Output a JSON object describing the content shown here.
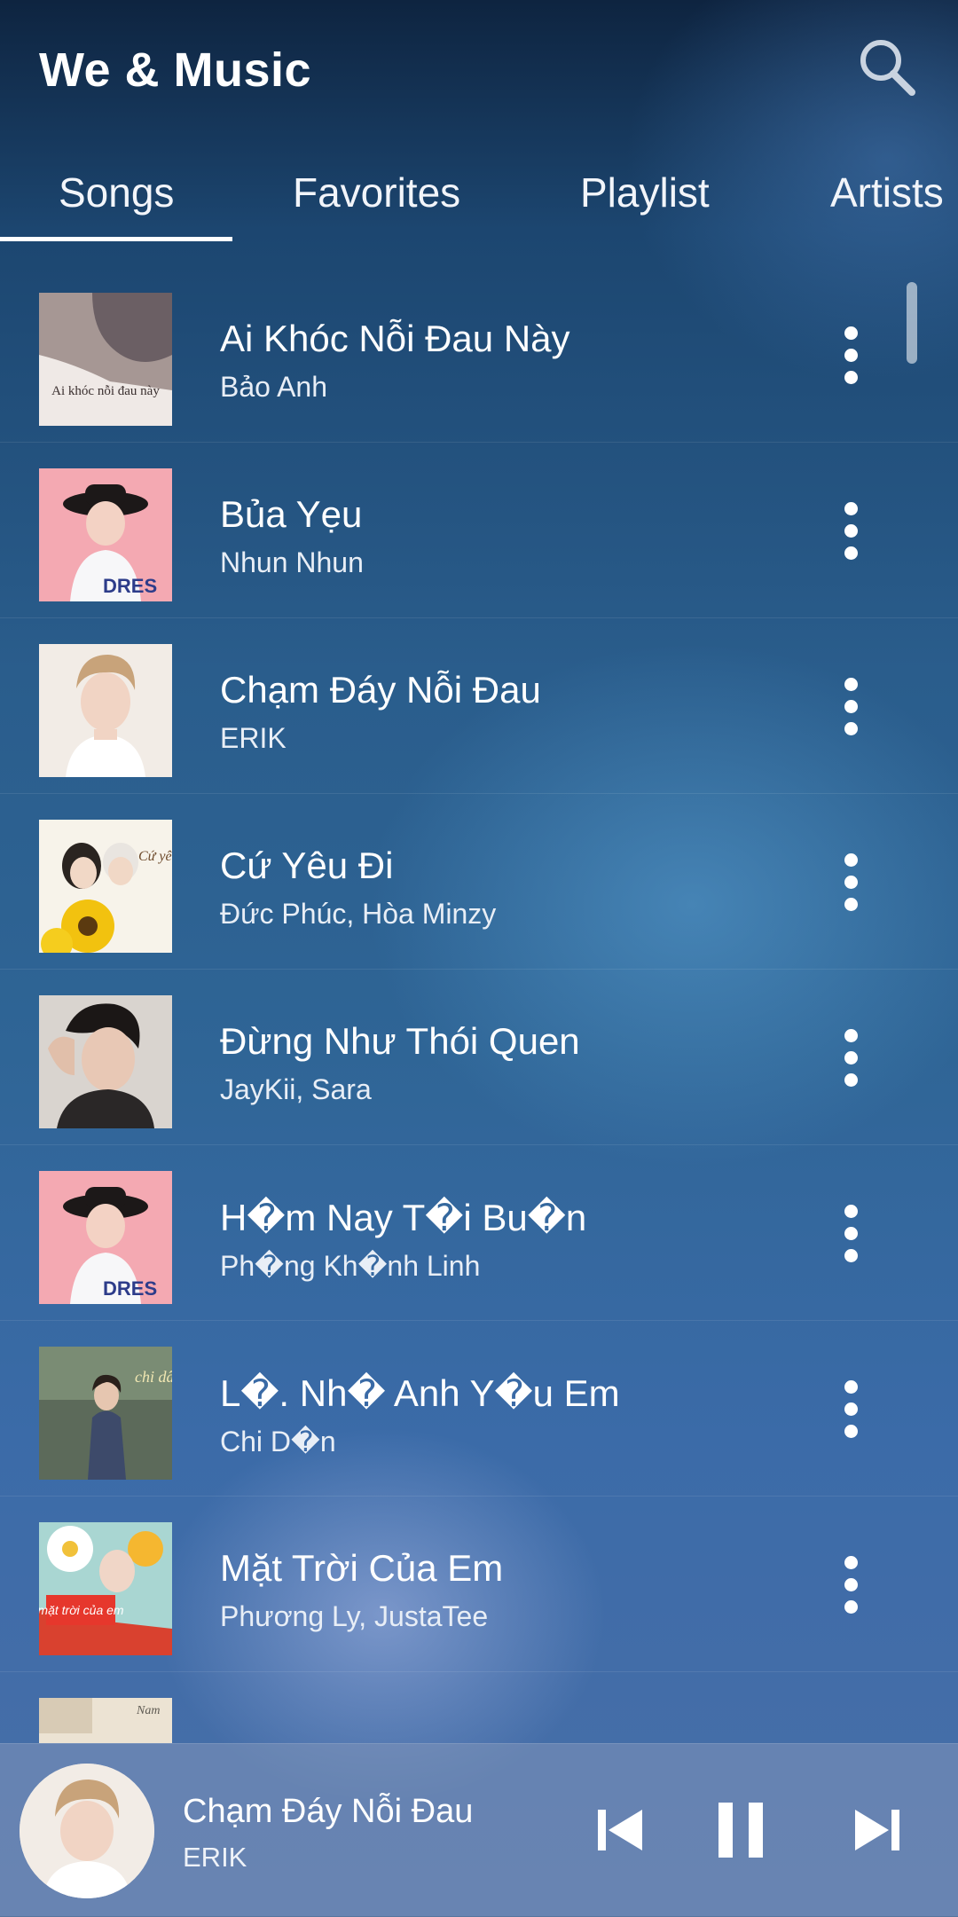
{
  "app": {
    "title": "We & Music"
  },
  "header": {
    "search_icon": "search-icon"
  },
  "tabs": [
    {
      "label": "Songs",
      "active": true
    },
    {
      "label": "Favorites",
      "active": false
    },
    {
      "label": "Playlist",
      "active": false
    },
    {
      "label": "Artists",
      "active": false
    }
  ],
  "songs": [
    {
      "title": "Ai Khóc Nỗi Đau Này",
      "artist": "Bảo Anh",
      "cover_text": "Ai khóc nỗi đau này"
    },
    {
      "title": "Bủa Yẹu",
      "artist": "Nhun Nhun",
      "cover_text": ""
    },
    {
      "title": "Chạm Đáy Nỗi Đau",
      "artist": "ERIK",
      "cover_text": ""
    },
    {
      "title": "Cứ Yêu Đi",
      "artist": "Đức Phúc, Hòa Minzy",
      "cover_text": "Cứ yêu đi"
    },
    {
      "title": "Đừng Như Thói Quen",
      "artist": "JayKii, Sara",
      "cover_text": ""
    },
    {
      "title": "H�m Nay T�i Bu�n",
      "artist": "Ph�ng Kh�nh Linh",
      "cover_text": ""
    },
    {
      "title": "L�. Nh� Anh Y�u Em",
      "artist": "Chi D�n",
      "cover_text": "chi dân"
    },
    {
      "title": "Mặt Trời Của Em",
      "artist": "Phương Ly, JustaTee",
      "cover_text": "mặt trời của em"
    },
    {
      "title": "",
      "artist": "",
      "cover_text": "Nam"
    }
  ],
  "player": {
    "title": "Chạm Đáy Nỗi Đau",
    "artist": "ERIK",
    "state": "playing",
    "controls": {
      "previous": "skip-previous-icon",
      "pause": "pause-icon",
      "next": "skip-next-icon"
    }
  },
  "colors": {
    "background_top": "#0e2440",
    "background_mid": "#2f6596",
    "text": "#ffffff"
  }
}
